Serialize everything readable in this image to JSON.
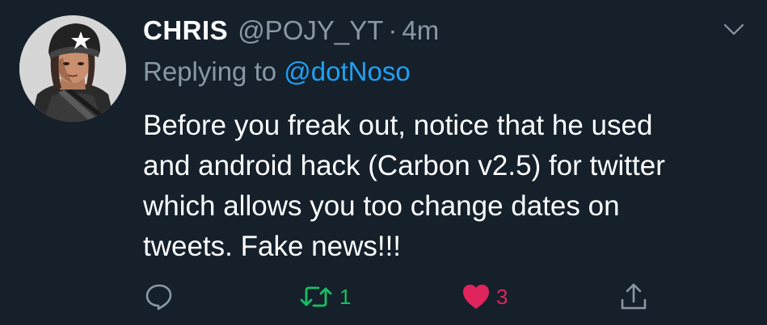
{
  "tweet": {
    "display_name": "CHRIS",
    "handle": "@POJY_YT",
    "separator": "·",
    "time": "4m",
    "replying_prefix": "Replying to",
    "replying_to": "@dotNoso",
    "text_lines": [
      "Before you freak out, notice that he used",
      "and android hack (Carbon v2.5) for twitter",
      "which allows you too change dates on",
      "tweets. Fake news!!!"
    ]
  },
  "actions": {
    "reply_icon": "reply-bubble-icon",
    "retweet_icon": "retweet-arrows-icon",
    "retweet_count": "1",
    "like_icon": "heart-icon",
    "like_count": "3",
    "share_icon": "share-upload-icon"
  },
  "menu_icon": "chevron-down-icon",
  "colors": {
    "background": "#15202b",
    "text_primary": "#ffffff",
    "text_secondary": "#8899a6",
    "link": "#1da1f2",
    "retweet_active": "#17bf63",
    "like_active": "#e0245e"
  }
}
